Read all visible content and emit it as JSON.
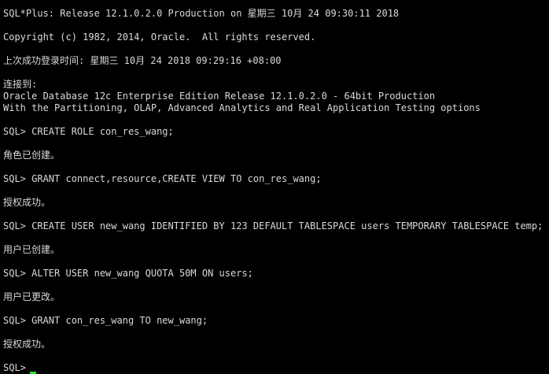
{
  "terminal": {
    "lines": [
      "SQL*Plus: Release 12.1.0.2.0 Production on 星期三 10月 24 09:30:11 2018",
      "",
      "Copyright (c) 1982, 2014, Oracle.  All rights reserved.",
      "",
      "上次成功登录时间: 星期三 10月 24 2018 09:29:16 +08:00",
      "",
      "连接到:",
      "Oracle Database 12c Enterprise Edition Release 12.1.0.2.0 - 64bit Production",
      "With the Partitioning, OLAP, Advanced Analytics and Real Application Testing options",
      "",
      "SQL> CREATE ROLE con_res_wang;",
      "",
      "角色已创建。",
      "",
      "SQL> GRANT connect,resource,CREATE VIEW TO con_res_wang;",
      "",
      "授权成功。",
      "",
      "SQL> CREATE USER new_wang IDENTIFIED BY 123 DEFAULT TABLESPACE users TEMPORARY TABLESPACE temp;",
      "",
      "用户已创建。",
      "",
      "SQL> ALTER USER new_wang QUOTA 50M ON users;",
      "",
      "用户已更改。",
      "",
      "SQL> GRANT con_res_wang TO new_wang;",
      "",
      "授权成功。",
      ""
    ],
    "prompt": "SQL> "
  },
  "colors": {
    "background": "#000000",
    "text": "#d9d9d9",
    "cursor": "#2fe02f"
  }
}
